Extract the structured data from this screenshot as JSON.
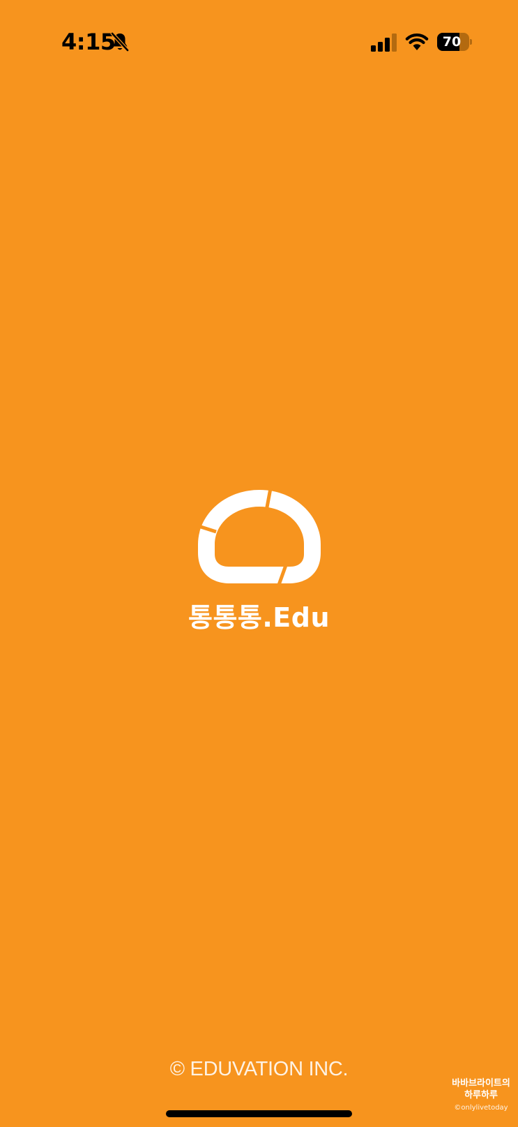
{
  "colors": {
    "background": "#F7941E",
    "foreground": "#FFFFFF",
    "status_text": "#000000"
  },
  "status_bar": {
    "time": "4:15",
    "silent_icon": "bell-slash-icon",
    "signal_icon": "cellular-signal-icon",
    "wifi_icon": "wifi-icon",
    "battery_level": "70",
    "battery_fraction": 0.7
  },
  "splash": {
    "logo_icon": "tongtongtong-logo-icon",
    "brand_name": "통통통.Edu"
  },
  "footer": {
    "copyright": "© EDUVATION INC."
  },
  "watermark": {
    "line1": "바바브라이트의",
    "line2": "하루하루",
    "handle": "©onlylivetoday"
  }
}
